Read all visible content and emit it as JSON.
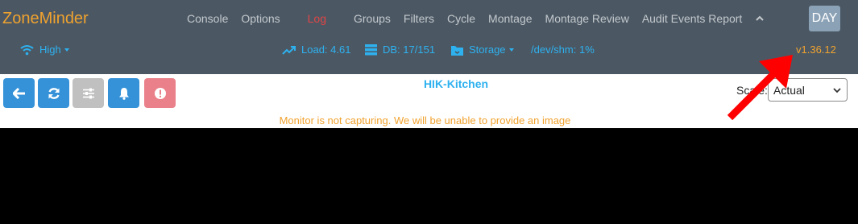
{
  "brand": "ZoneMinder",
  "nav": {
    "items": [
      {
        "label": "Console",
        "active": false
      },
      {
        "label": "Options",
        "active": false
      },
      {
        "label": "Log",
        "active": true
      },
      {
        "label": "Groups",
        "active": false
      },
      {
        "label": "Filters",
        "active": false
      },
      {
        "label": "Cycle",
        "active": false
      },
      {
        "label": "Montage",
        "active": false
      },
      {
        "label": "Montage Review",
        "active": false
      },
      {
        "label": "Audit Events Report",
        "active": false
      }
    ],
    "collapse_icon": "chevron-up-icon",
    "day_button": "DAY"
  },
  "status": {
    "bandwidth": "High",
    "load": "Load: 4.61",
    "db": "DB: 17/151",
    "storage": "Storage",
    "shm": "/dev/shm: 1%",
    "version": "v1.36.12"
  },
  "toolbar": {
    "buttons": [
      {
        "name": "back-button",
        "icon": "arrow-left-icon"
      },
      {
        "name": "refresh-button",
        "icon": "refresh-icon"
      },
      {
        "name": "settings-button",
        "icon": "sliders-icon"
      },
      {
        "name": "alarm-button",
        "icon": "bell-icon"
      },
      {
        "name": "alert-button",
        "icon": "exclamation-icon"
      }
    ]
  },
  "monitor": {
    "title": "HIK-Kitchen",
    "scale_label": "Scale:",
    "scale_value": "Actual",
    "warning": "Monitor is not capturing. We will be unable to provide an image"
  },
  "colors": {
    "navbar": "#4b5864",
    "brand": "#f0a22e",
    "accent": "#2eb1ef",
    "active_nav": "#e04444",
    "annotation": "#ff0000"
  }
}
